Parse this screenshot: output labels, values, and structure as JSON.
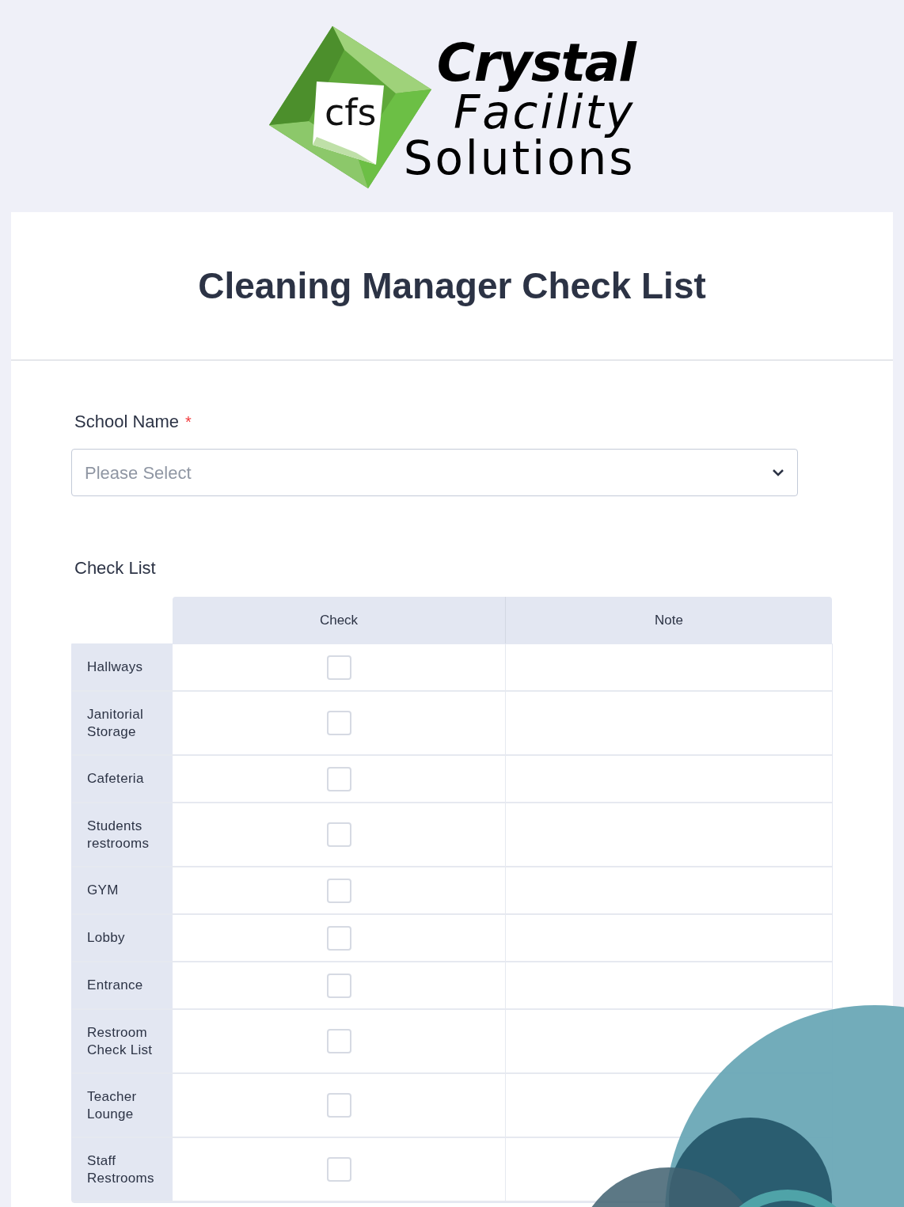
{
  "logo": {
    "monogram": "cfs",
    "lines": [
      "Crystal",
      "Facility",
      "Solutions"
    ]
  },
  "title": "Cleaning Manager Check List",
  "school_name": {
    "label": "School Name",
    "required": true,
    "required_mark": "*",
    "placeholder": "Please Select"
  },
  "check_list": {
    "label": "Check List",
    "columns": [
      "Check",
      "Note"
    ],
    "rows": [
      {
        "label": "Hallways",
        "checked": false
      },
      {
        "label": "Janitorial Storage",
        "checked": false
      },
      {
        "label": "Cafeteria",
        "checked": false
      },
      {
        "label": "Students restrooms",
        "checked": false
      },
      {
        "label": "GYM",
        "checked": false
      },
      {
        "label": "Lobby",
        "checked": false
      },
      {
        "label": "Entrance",
        "checked": false
      },
      {
        "label": "Restroom Check List",
        "checked": false
      },
      {
        "label": "Teacher Lounge",
        "checked": false
      },
      {
        "label": "Staff Restrooms",
        "checked": false
      }
    ]
  }
}
